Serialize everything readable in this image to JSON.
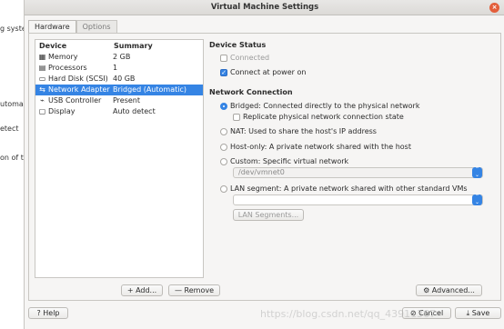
{
  "background": {
    "snippets": [
      "g syste",
      "utoma",
      "etect",
      "on of t"
    ]
  },
  "window": {
    "title": "Virtual Machine Settings",
    "close_glyph": "×"
  },
  "tabs": [
    "Hardware",
    "Options"
  ],
  "device_list": {
    "headers": {
      "device": "Device",
      "summary": "Summary"
    },
    "rows": [
      {
        "icon": "memory-icon",
        "glyph": "▦",
        "device": "Memory",
        "summary": "2 GB"
      },
      {
        "icon": "processor-icon",
        "glyph": "▤",
        "device": "Processors",
        "summary": "1"
      },
      {
        "icon": "hard-disk-icon",
        "glyph": "▭",
        "device": "Hard Disk (SCSI)",
        "summary": "40 GB"
      },
      {
        "icon": "network-adapter-icon",
        "glyph": "⇆",
        "device": "Network Adapter",
        "summary": "Bridged (Automatic)",
        "selected": true
      },
      {
        "icon": "usb-icon",
        "glyph": "⌁",
        "device": "USB Controller",
        "summary": "Present"
      },
      {
        "icon": "display-icon",
        "glyph": "▢",
        "device": "Display",
        "summary": "Auto detect"
      }
    ],
    "add_label": "Add...",
    "remove_label": "Remove"
  },
  "device_status": {
    "title": "Device Status",
    "connected": {
      "label": "Connected",
      "checked": false
    },
    "connect_at_power_on": {
      "label": "Connect at power on",
      "checked": true
    }
  },
  "network_connection": {
    "title": "Network Connection",
    "bridged": "Bridged: Connected directly to the physical network",
    "replicate": "Replicate physical network connection state",
    "nat": "NAT: Used to share the host's IP address",
    "host_only": "Host-only: A private network shared with the host",
    "custom": "Custom: Specific virtual network",
    "custom_value": "/dev/vmnet0",
    "lan_segment": "LAN segment: A private network shared with other standard VMs",
    "lan_value": "",
    "lan_segments_button": "LAN Segments...",
    "selected": "bridged"
  },
  "advanced_label": "Advanced...",
  "footer": {
    "help_label": "Help",
    "cancel_label": "Cancel",
    "save_label": "Save"
  },
  "watermark": "https://blog.csdn.net/qq_43911367"
}
